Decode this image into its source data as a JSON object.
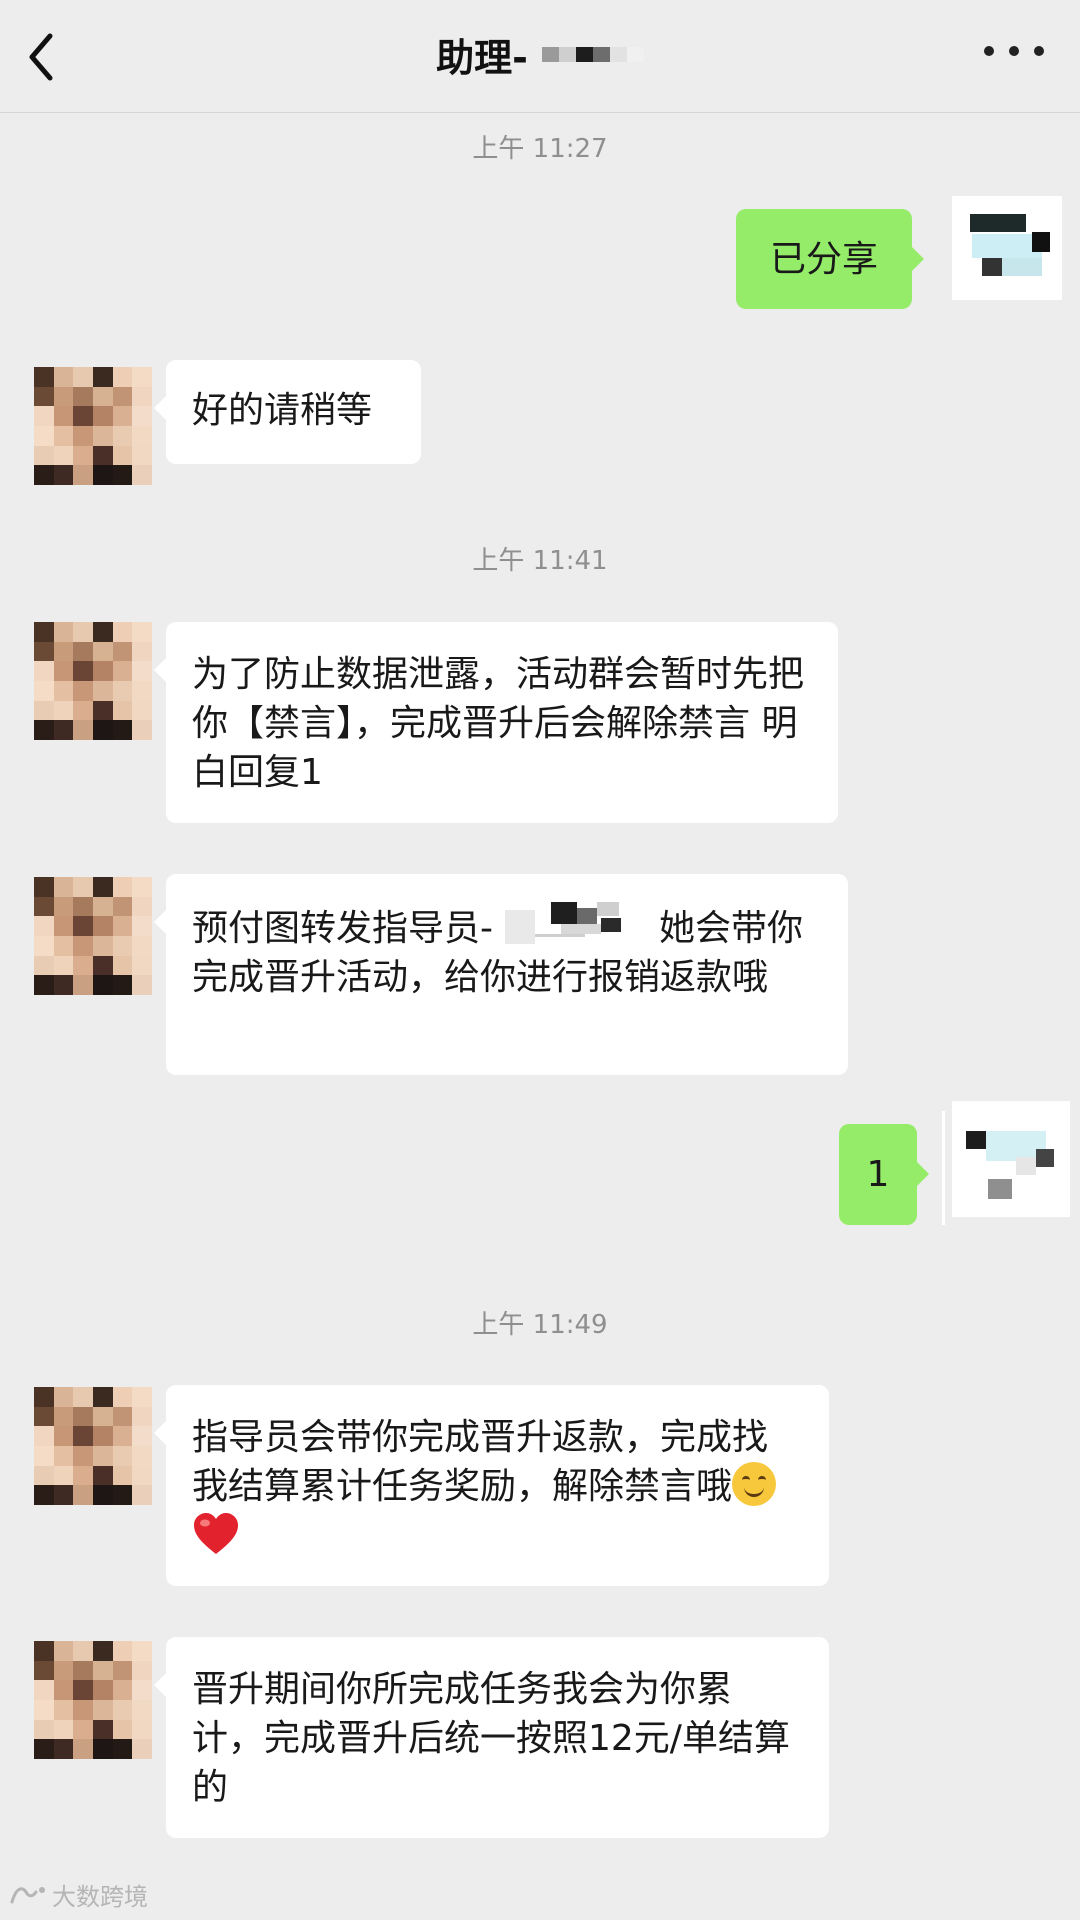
{
  "header": {
    "title": "助理-",
    "back_icon": "chevron-left-icon",
    "more_icon": "more-dots-icon"
  },
  "timestamps": [
    "上午 11:27",
    "上午 11:41",
    "上午 11:49"
  ],
  "messages": {
    "m1": "已分享",
    "m2": "好的请稍等",
    "m3": "为了防止数据泄露，活动群会暂时先把你【禁言】，完成晋升后会解除禁言 明白回复1",
    "m4_before": "预付图转发指导员-",
    "m4_after": "她会带你完成晋升活动，给你进行报销返款哦",
    "m5": "1",
    "m6": "指导员会带你完成晋升返款，完成找我结算累计任务奖励，解除禁言哦",
    "m7": "晋升期间你所完成任务我会为你累计，完成晋升后统一按照12元/单结算的"
  },
  "watermark": "大数跨境",
  "colors": {
    "background": "#ededed",
    "outgoing_bubble": "#95ec69",
    "incoming_bubble": "#ffffff",
    "timestamp_text": "#8f8f8f"
  }
}
